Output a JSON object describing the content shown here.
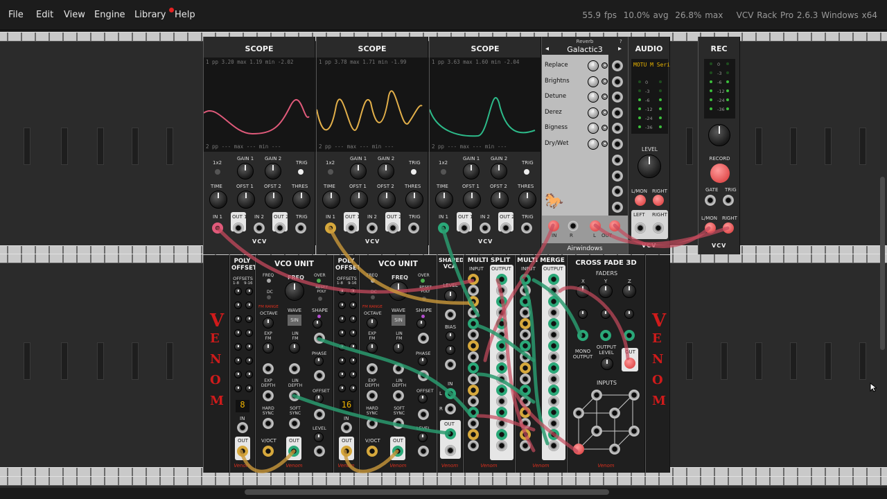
{
  "menu": {
    "file": "File",
    "edit": "Edit",
    "view": "View",
    "engine": "Engine",
    "library": "Library",
    "help": "Help"
  },
  "status": {
    "fps": "55.9 fps",
    "avg": "10.0% avg",
    "max": "26.8% max",
    "app": "VCV Rack Pro 2.6.3 Windows x64"
  },
  "scopes": [
    {
      "title": "SCOPE",
      "top": "1 pp  3.20 max  1.19 min -2.02",
      "bottom": "2 pp  ---  max  ---  min  ---",
      "trace": "#e05a7a",
      "in1_color": "#e05a7a"
    },
    {
      "title": "SCOPE",
      "top": "1 pp  3.78 max  1.71 min -1.99",
      "bottom": "2 pp  ---  max  ---  min  ---",
      "trace": "#e3b04a",
      "in1_color": "#d6a83c"
    },
    {
      "title": "SCOPE",
      "top": "1 pp  3.63 max  1.60 min -2.04",
      "bottom": "2 pp  ---  max  ---  min  ---",
      "trace": "#2dbb8a",
      "in1_color": "#2aa878"
    }
  ],
  "scope_labels": {
    "mode": "1x2",
    "gain1": "GAIN 1",
    "gain2": "GAIN 2",
    "trig": "TRIG",
    "time": "TIME",
    "ofst1": "OFST 1",
    "ofst2": "OFST 2",
    "thres": "THRES",
    "in1": "IN 1",
    "out1": "OUT 1",
    "in2": "IN 2",
    "out2": "OUT 2",
    "trig_in": "TRIG",
    "brand": "VCV"
  },
  "reverb": {
    "header": "Reverb",
    "preset": "Galactic3",
    "help": "?",
    "prev": "◂",
    "next": "▸",
    "params": [
      "Replace",
      "Brightns",
      "Detune",
      "Derez",
      "Bigness",
      "Dry/Wet"
    ],
    "in_label": "IN",
    "r": "R",
    "l": "L",
    "out_label": "OUT",
    "brand": "Airwindows"
  },
  "audio": {
    "title": "AUDIO",
    "device": "MOTU M Seri",
    "meter": [
      "0",
      "-3",
      "-6",
      "-12",
      "-24",
      "-36"
    ],
    "level": "LEVEL",
    "lmon": "L/MON",
    "right": "RIGHT",
    "left": "LEFT",
    "brand": "VCV"
  },
  "rec": {
    "title": "REC",
    "meter": [
      "0",
      "-3",
      "-6",
      "-12",
      "-24",
      "-36"
    ],
    "record": "RECORD",
    "gate": "GATE",
    "trig": "TRIG",
    "lmon": "L/MON",
    "right": "RIGHT",
    "brand": "VCV"
  },
  "poly_offset": {
    "title": "POLY OFFSET",
    "offsets": "OFFSETS",
    "range1": "1-8",
    "range2": "9-16",
    "in": "IN",
    "out": "OUT",
    "brand": "Venom",
    "count1": "8",
    "count2": "16"
  },
  "vco": {
    "title": "VCO UNIT",
    "freq": "FREQ",
    "over": "OVER",
    "dc": "DC",
    "reset_poly": "RESET POLY",
    "fm_range": "FM RANGE",
    "octave": "OCTAVE",
    "wave": "WAVE",
    "shape": "SHAPE",
    "sin": "SIN",
    "exp_fm": "EXP FM",
    "lin_fm": "LIN FM",
    "phase": "PHASE",
    "exp_depth": "EXP DEPTH",
    "lin_depth": "LIN DEPTH",
    "offset": "OFFSET",
    "hard_sync": "HARD SYNC",
    "soft_sync": "SOFT SYNC",
    "level": "LEVEL",
    "voct": "V/OCT",
    "out": "OUT",
    "brand": "Venom"
  },
  "shaped_vca": {
    "title": "SHAPED VCA",
    "level": "LEVEL",
    "bias": "BIAS",
    "in": "IN",
    "out": "OUT",
    "l": "L",
    "r": "R",
    "brand": "Venom"
  },
  "multi_split": {
    "title": "MULTI SPLIT",
    "input": "INPUT",
    "output": "OUTPUT",
    "brand": "Venom"
  },
  "multi_merge": {
    "title": "MULTI MERGE",
    "input": "INPUT",
    "output": "OUTPUT",
    "brand": "Venom"
  },
  "crossfade": {
    "title": "CROSS FADE 3D",
    "faders": "FADERS",
    "x": "X",
    "y": "Y",
    "z": "Z",
    "mono_output": "MONO OUTPUT",
    "output_level": "OUTPUT LEVEL",
    "out": "OUT",
    "inputs": "INPUTS",
    "brand": "Venom"
  },
  "venom_logo": [
    "V",
    "E",
    "N",
    "O",
    "M"
  ]
}
